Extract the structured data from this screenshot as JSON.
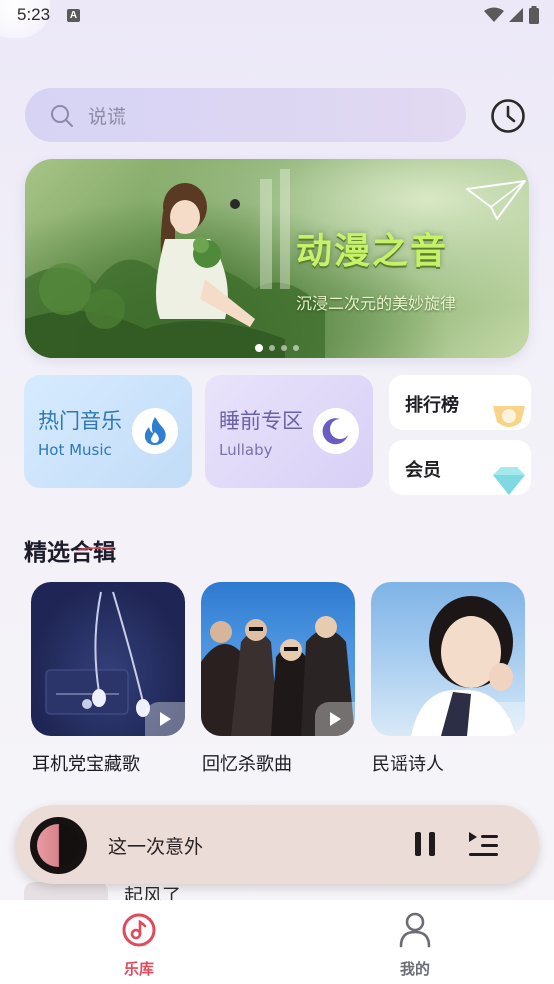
{
  "status_bar": {
    "time": "5:23",
    "notification_icon": "A"
  },
  "search": {
    "placeholder": "说谎",
    "icon": "search-icon"
  },
  "header": {
    "history_icon": "clock-icon"
  },
  "banner": {
    "title": "动漫之音",
    "subtitle": "沉浸二次元的美妙旋律",
    "page_count": 4,
    "active_page": 0
  },
  "quick_cards": {
    "hot": {
      "title": "热门音乐",
      "subtitle": "Hot Music",
      "icon": "flame-icon"
    },
    "sleep": {
      "title": "睡前专区",
      "subtitle": "Lullaby",
      "icon": "moon-icon"
    },
    "rank": {
      "label": "排行榜",
      "icon": "trophy-icon"
    },
    "vip": {
      "label": "会员",
      "icon": "diamond-icon"
    }
  },
  "featured": {
    "title": "精选合辑",
    "albums": [
      {
        "name": "耳机党宝藏歌"
      },
      {
        "name": "回忆杀歌曲"
      },
      {
        "name": "民谣诗人"
      }
    ]
  },
  "player": {
    "title": "这一次意外",
    "pause_icon": "pause-icon",
    "playlist_icon": "playlist-icon"
  },
  "next_item": {
    "title": "起风了"
  },
  "nav": {
    "items": [
      {
        "label": "乐库",
        "icon": "music-note-icon",
        "active": true
      },
      {
        "label": "我的",
        "icon": "user-icon",
        "active": false
      }
    ]
  },
  "colors": {
    "accent": "#e14a5b",
    "player_bg": "#ebdcd8",
    "banner_title": "#c6f26a"
  }
}
